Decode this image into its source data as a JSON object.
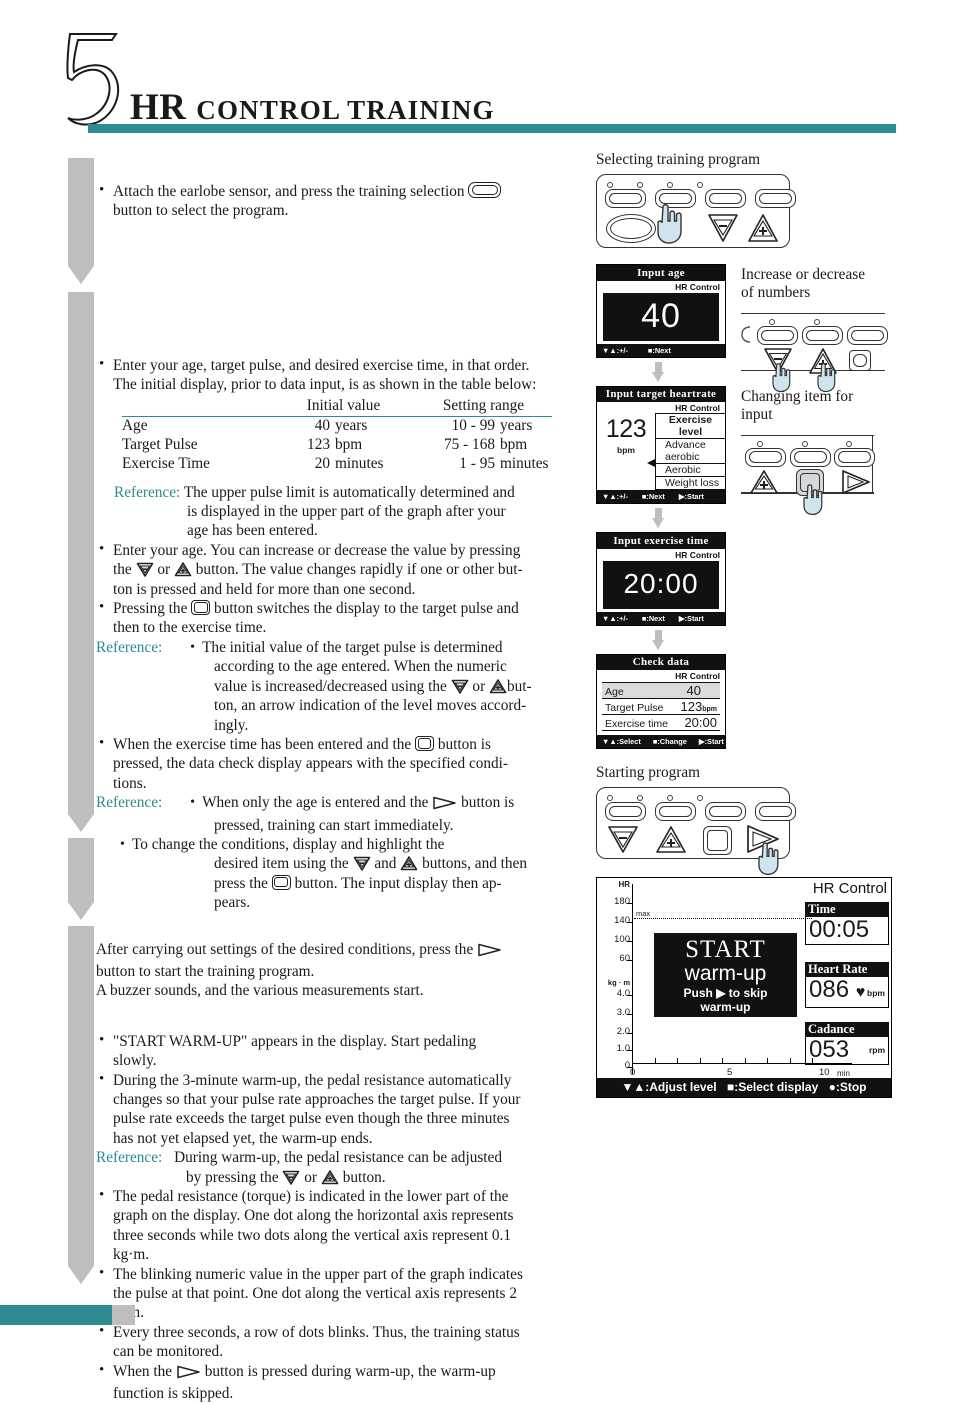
{
  "header": {
    "chapter_number": "5",
    "title_primary": "HR",
    "title_rest": "CONTROL TRAINING",
    "accent_color": "#2e8b92"
  },
  "left_column": {
    "step1": {
      "text_a": "Attach the earlobe sensor, and press the training selection",
      "text_b": "button to select the program.",
      "icon": "pill-button-icon"
    },
    "step2": {
      "line1": "Enter your age, target pulse, and desired exercise time, in that order.",
      "line2": "The initial display, prior to data input, is as shown in the table below:"
    },
    "table": {
      "headers": [
        "",
        "Initial value",
        "Setting range"
      ],
      "rows": [
        {
          "name": "Age",
          "initial_value": "40",
          "initial_unit": "years",
          "range": "10 - 99",
          "range_unit": "years"
        },
        {
          "name": "Target Pulse",
          "initial_value": "123",
          "initial_unit": "bpm",
          "range": "75 - 168",
          "range_unit": "bpm"
        },
        {
          "name": "Exercise Time",
          "initial_value": "20",
          "initial_unit": "minutes",
          "range": "1 - 95",
          "range_unit": "minutes"
        }
      ]
    },
    "ref1": {
      "label": "Reference:",
      "l1": "The upper pulse limit is automatically determined and",
      "l2": "is displayed in the upper part of the graph after your",
      "l3": "age has been entered."
    },
    "b_age": {
      "p1": "Enter your age. You can increase or decrease the value by pressing",
      "p2a": "the",
      "p2b": "or",
      "p2c": "button. The value changes rapidly if one or other but-",
      "p3": "ton is pressed and held for more than one second."
    },
    "b_press": {
      "p1a": "Pressing the",
      "p1b": "button switches the display to the target pulse and",
      "p2": "then to the exercise time."
    },
    "ref2": {
      "label": "Reference:",
      "l1": "The initial value of the target pulse is determined",
      "l2": "according to the age entered. When the numeric",
      "l3a": "value is increased/decreased using the",
      "l3b": "or",
      "l3c": "but-",
      "l4": "ton, an arrow indication of the level moves accord-",
      "l5": "ingly."
    },
    "b_exercise": {
      "p1a": "When the exercise time has been entered and the",
      "p1b": "button is",
      "p2": "pressed, the data check display appears with the specified condi-",
      "p3": "tions."
    },
    "ref3": {
      "label": "Reference:",
      "i1a": "When only the age is entered and the",
      "i1b": "button is",
      "i1c": "pressed, training can start immediately.",
      "i2a": "To change the conditions, display and highlight the",
      "i2b": "desired item using the",
      "i2c": "and",
      "i2d": "buttons, and then",
      "i2e": "press the",
      "i2f": "button. The input display then ap-",
      "i2g": "pears."
    },
    "after": {
      "l1a": "After carrying out settings of the desired conditions, press the",
      "l2": "button to start the training program.",
      "l3": "A buzzer sounds, and the various measurements start."
    },
    "b_warm": {
      "p1": "\"START WARM-UP\" appears in the display. Start pedaling",
      "p2": "slowly."
    },
    "b_3min": {
      "p1": "During the 3-minute warm-up, the pedal resistance automatically",
      "p2": "changes so that your pulse rate approaches the target pulse. If your",
      "p3": "pulse rate exceeds the target pulse even though the three minutes",
      "p4": "has not yet elapsed yet, the warm-up ends."
    },
    "ref4": {
      "label": "Reference:",
      "l1": "During warm-up, the pedal resistance can be adjusted",
      "l2a": "by pressing the",
      "l2b": "or",
      "l2c": "button."
    },
    "b_torque": {
      "p1": "The pedal resistance (torque) is indicated in the lower part of the",
      "p2": "graph on the display. One dot along the horizontal axis represents",
      "p3": "three seconds while two dots along the vertical axis represent 0.1",
      "p4": "kg·m."
    },
    "b_blink": {
      "p1": "The blinking numeric value in the upper part of the graph indicates",
      "p2": "the pulse at that point. One dot along the vertical axis represents 2",
      "p3": "bpm."
    },
    "b_every": {
      "p1": "Every three seconds, a row of dots blinks. Thus, the training status",
      "p2": "can be monitored."
    },
    "b_skip": {
      "p1a": "When the",
      "p1b": "button is pressed during warm-up, the warm-up",
      "p2": "function is skipped."
    }
  },
  "right_column": {
    "captions": {
      "selecting": "Selecting training program",
      "increase": "Increase or decrease\nof numbers",
      "increase_l1": "Increase or decrease",
      "increase_l2": "of numbers",
      "changing_l1": "Changing item for",
      "changing_l2": "input",
      "starting": "Starting program"
    },
    "lcd_panels": [
      {
        "title": "Input age",
        "mode": "HR Control",
        "value": "40",
        "footer": [
          "▼▲:+/-",
          "■:Next"
        ]
      },
      {
        "title": "Input target heartrate",
        "mode": "HR Control",
        "value": "123",
        "unit": "bpm",
        "list_title": "Exercise level",
        "list_items": [
          "Advance aerobic",
          "Aerobic",
          "Weight loss"
        ],
        "selected_index": 1,
        "footer": [
          "▼▲:+/-",
          "■:Next",
          "▶:Start"
        ]
      },
      {
        "title": "Input exercise time",
        "mode": "HR Control",
        "value": "20:00",
        "footer": [
          "▼▲:+/-",
          "■:Next",
          "▶:Start"
        ]
      },
      {
        "title": "Check data",
        "mode": "HR Control",
        "rows": [
          {
            "label": "Age",
            "value": "40",
            "unit": ""
          },
          {
            "label": "Target Pulse",
            "value": "123",
            "unit": "bpm"
          },
          {
            "label": "Exercise time",
            "value": "20:00",
            "unit": ""
          }
        ],
        "footer": [
          "▼▲:Select",
          "■:Change",
          "▶:Start"
        ]
      }
    ],
    "main_display": {
      "mode": "HR Control",
      "hr_axis_label": "HR",
      "hr_ticks": [
        "180",
        "140",
        "100",
        "60"
      ],
      "max_label": "max",
      "torque_axis_label": "kg · m",
      "torque_ticks": [
        "4.0",
        "3.0",
        "2.0",
        "1.0",
        "0"
      ],
      "x_ticks": [
        "0",
        "5",
        "10"
      ],
      "x_unit": "min",
      "message_line1": "START",
      "message_line2": "warm-up",
      "skip_line1": "Push ▶ to skip",
      "skip_line2": "warm-up",
      "stats": [
        {
          "label": "Time",
          "value": "00:05",
          "unit": ""
        },
        {
          "label": "Heart Rate",
          "value": "086",
          "unit": "bpm",
          "icon": "heart-icon"
        },
        {
          "label": "Cadance",
          "value": "053",
          "unit": "rpm"
        }
      ],
      "footer": "▼▲:Adjust level  ■:Select display  ●:Stop",
      "footer_parts": [
        "▼▲:Adjust level",
        "■:Select display",
        "●:Stop"
      ]
    }
  }
}
